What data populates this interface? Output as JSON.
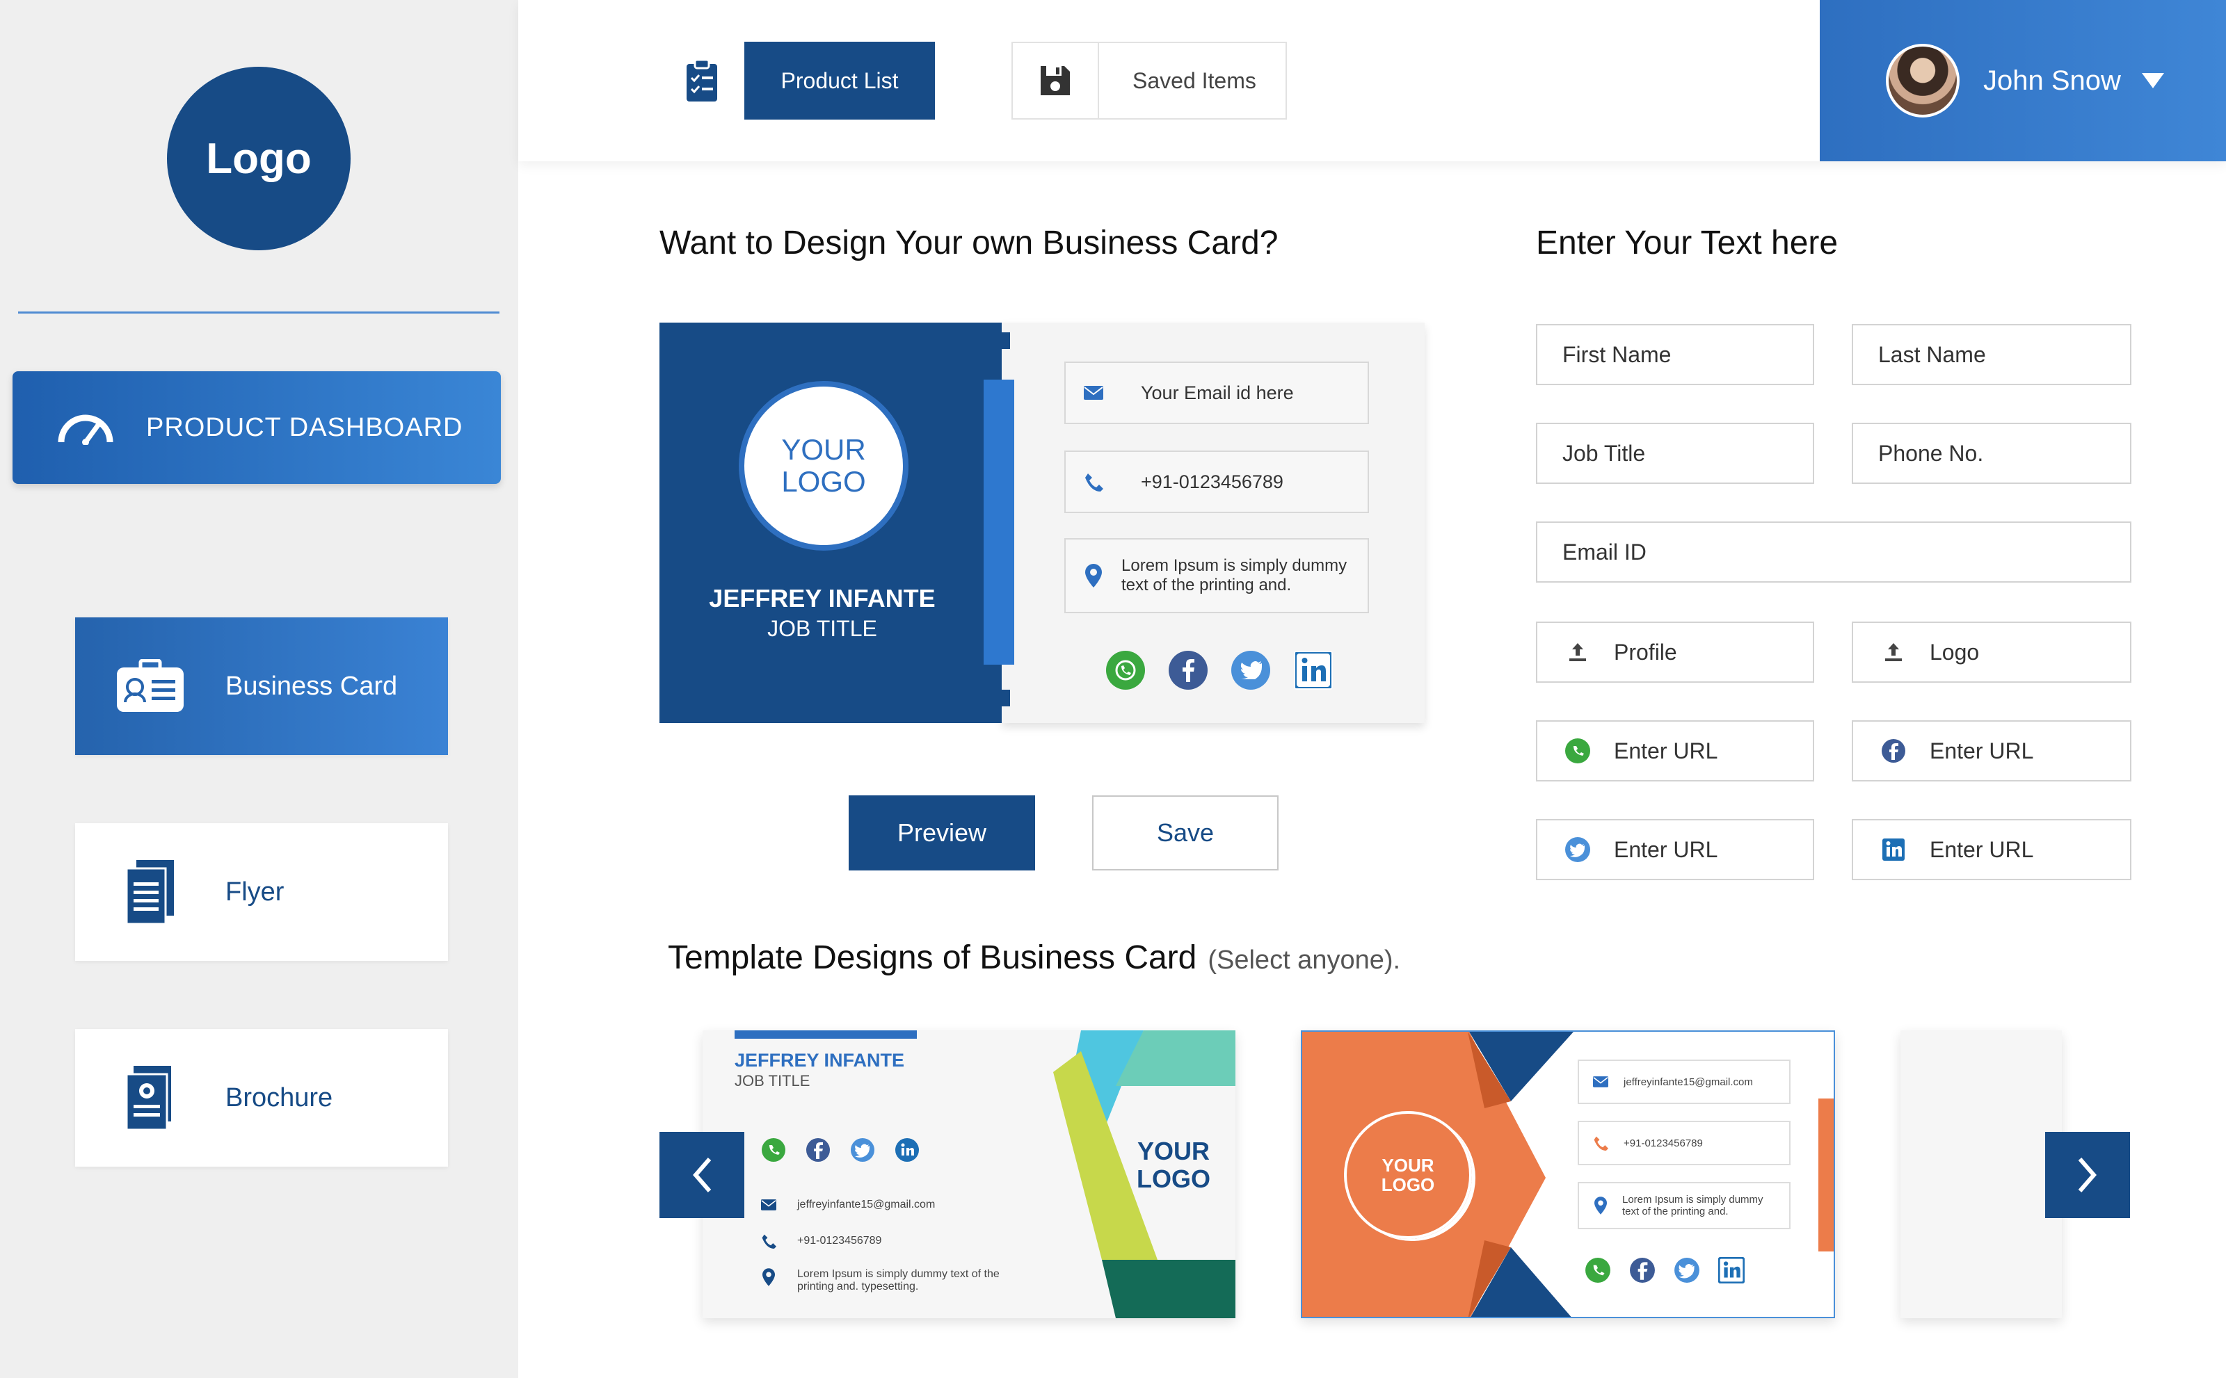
{
  "sidebar": {
    "logo": "Logo",
    "dashboard": "PRODUCT DASHBOARD",
    "items": [
      {
        "label": "Business Card",
        "icon": "id-card-icon"
      },
      {
        "label": "Flyer",
        "icon": "flyer-icon"
      },
      {
        "label": "Brochure",
        "icon": "brochure-icon"
      }
    ]
  },
  "topbar": {
    "product_list": "Product List",
    "saved_items": "Saved Items",
    "user_name": "John Snow"
  },
  "designer": {
    "heading": "Want to Design Your own Business Card?",
    "card": {
      "logo_line1": "YOUR",
      "logo_line2": "LOGO",
      "name": "JEFFREY INFANTE",
      "job": "JOB TITLE",
      "email": "Your Email id here",
      "phone": "+91-0123456789",
      "address_line1": "Lorem Ipsum is simply dummy",
      "address_line2": "text of the printing and."
    },
    "preview": "Preview",
    "save": "Save"
  },
  "form": {
    "heading": "Enter Your Text here",
    "first_name": "First Name",
    "last_name": "Last Name",
    "job_title": "Job Title",
    "phone": "Phone No.",
    "email": "Email ID",
    "profile": "Profile",
    "logo": "Logo",
    "whatsapp_url": "Enter URL",
    "facebook_url": "Enter URL",
    "twitter_url": "Enter URL",
    "linkedin_url": "Enter URL"
  },
  "templates": {
    "heading": "Template Designs of Business Card",
    "hint": "(Select anyone).",
    "t1": {
      "name": "JEFFREY INFANTE",
      "job": "JOB TITLE",
      "logo_line1": "YOUR",
      "logo_line2": "LOGO",
      "email": "jeffreyinfante15@gmail.com",
      "phone": "+91-0123456789",
      "address_line1": "Lorem Ipsum is simply dummy text of the",
      "address_line2": "printing and. typesetting."
    },
    "t2": {
      "logo_line1": "YOUR",
      "logo_line2": "LOGO",
      "email": "jeffreyinfante15@gmail.com",
      "phone": "+91-0123456789",
      "address_line1": "Lorem Ipsum is simply dummy",
      "address_line2": "text of the printing and."
    }
  },
  "colors": {
    "primary": "#174b86",
    "accent": "#2e6fc0",
    "whatsapp": "#3aa83f",
    "facebook": "#3d5b96",
    "twitter": "#4a90d9",
    "linkedin": "#1d6fb5",
    "orange": "#ec7c4a"
  }
}
